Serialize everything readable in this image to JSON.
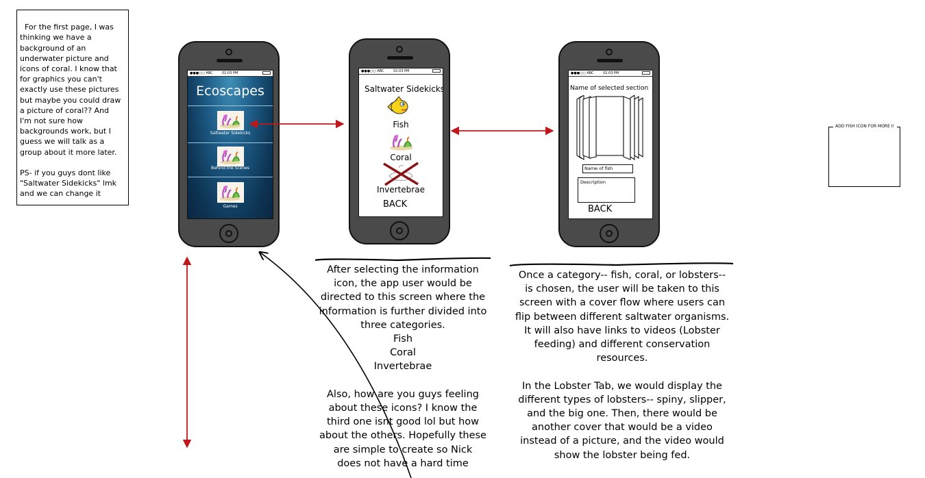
{
  "sticky_note": {
    "text": "For the first page, I was\nthinking we have a\nbackground of an\nunderwater picture and\nicons of coral. I know that\nfor graphics you can't\nexactly use these pictures\nbut maybe you could draw\na picture of coral?? And\nI'm not sure how\nbackgrounds work, but I\nguess we will talk as a\ngroup about it more later.\n\nPS- if you guys dont like\n\"Saltwater Sidekicks\" lmk\nand we can change it"
  },
  "status_bar": {
    "carrier": "●●●○○ ABC",
    "time": "02:03 PM"
  },
  "phone1": {
    "title": "Ecoscapes",
    "rows": [
      {
        "label": "Saltwater Sidekicks"
      },
      {
        "label": "Behind the Scenes"
      },
      {
        "label": "Games"
      }
    ]
  },
  "phone2": {
    "header": "Saltwater Sidekicks",
    "categories": [
      {
        "label": "Fish"
      },
      {
        "label": "Coral"
      },
      {
        "label": "Invertebrae"
      }
    ],
    "back_label": "BACK"
  },
  "phone3": {
    "header": "Name of selected section",
    "name_field": "Name of fish",
    "description_field": "Description",
    "back_label": "BACK"
  },
  "caption2": "After selecting the information\nicon, the app user would be\ndirected to this screen where the\ninformation is further divided into\nthree categories.\nFish\nCoral\nInvertebrae\n\nAlso, how are you guys feeling\nabout these icons? I know the\nthird one isnt good lol but how\nabout the others. Hopefully these\nare simple to create so Nick\ndoes not have a hard time",
  "caption3": "Once a category-- fish, coral, or lobsters--\nis chosen, the user will be taken to this\nscreen with a cover flow where users can\nflip between different saltwater organisms.\nIt will also have links to videos (Lobster\nfeeding) and different conservation\nresources.\n\nIn the Lobster Tab, we would display the\ndifferent types of lobsters-- spiny, slipper,\nand the big one. Then, there would be\nanother cover that would be a video\ninstead of a picture, and the video would\nshow the lobster being fed.",
  "placeholder_box": {
    "label": "ADD FISH ICON FOR MORE I!"
  },
  "colors": {
    "arrow_red": "#c0171b",
    "phone_body": "#4a4a4a",
    "water_dark": "#0e3656"
  }
}
